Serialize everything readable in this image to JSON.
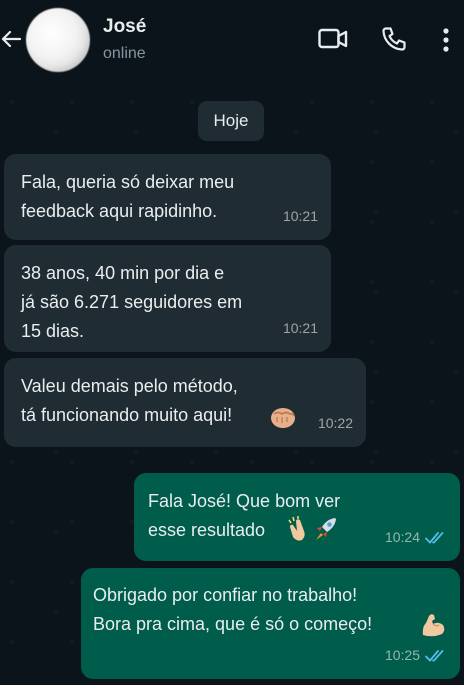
{
  "header": {
    "contact_name": "José",
    "contact_status": "online"
  },
  "chat": {
    "date_label": "Hoje",
    "messages": [
      {
        "direction": "in",
        "text": "Fala, queria só deixar meu\nfeedback aqui rapidinho.",
        "time": "10:21"
      },
      {
        "direction": "in",
        "text": "38 anos, 40 min por dia e\njá são 6.271 seguidores em\n15 dias.",
        "time": "10:21"
      },
      {
        "direction": "in",
        "text": "Valeu demais pelo método,\ntá funcionando muito aqui!",
        "emoji": "punch-emoji",
        "time": "10:22"
      },
      {
        "direction": "out",
        "text": "Fala José! Que bom ver\nesse resultado",
        "emoji": "clap-rocket-emoji",
        "time": "10:24",
        "status": "read"
      },
      {
        "direction": "out",
        "text": "Obrigado por confiar no trabalho!\nBora pra cima, que é só o começo!",
        "emoji": "flexed-biceps-emoji",
        "time": "10:25",
        "status": "read"
      }
    ]
  },
  "colors": {
    "background": "#0b141a",
    "incoming_bubble": "#202c33",
    "outgoing_bubble": "#005c4b",
    "read_ticks": "#53bdeb",
    "secondary_text": "#8696a0"
  },
  "icons": [
    "back-arrow-icon",
    "video-call-icon",
    "phone-icon",
    "more-vertical-icon",
    "double-check-icon"
  ]
}
